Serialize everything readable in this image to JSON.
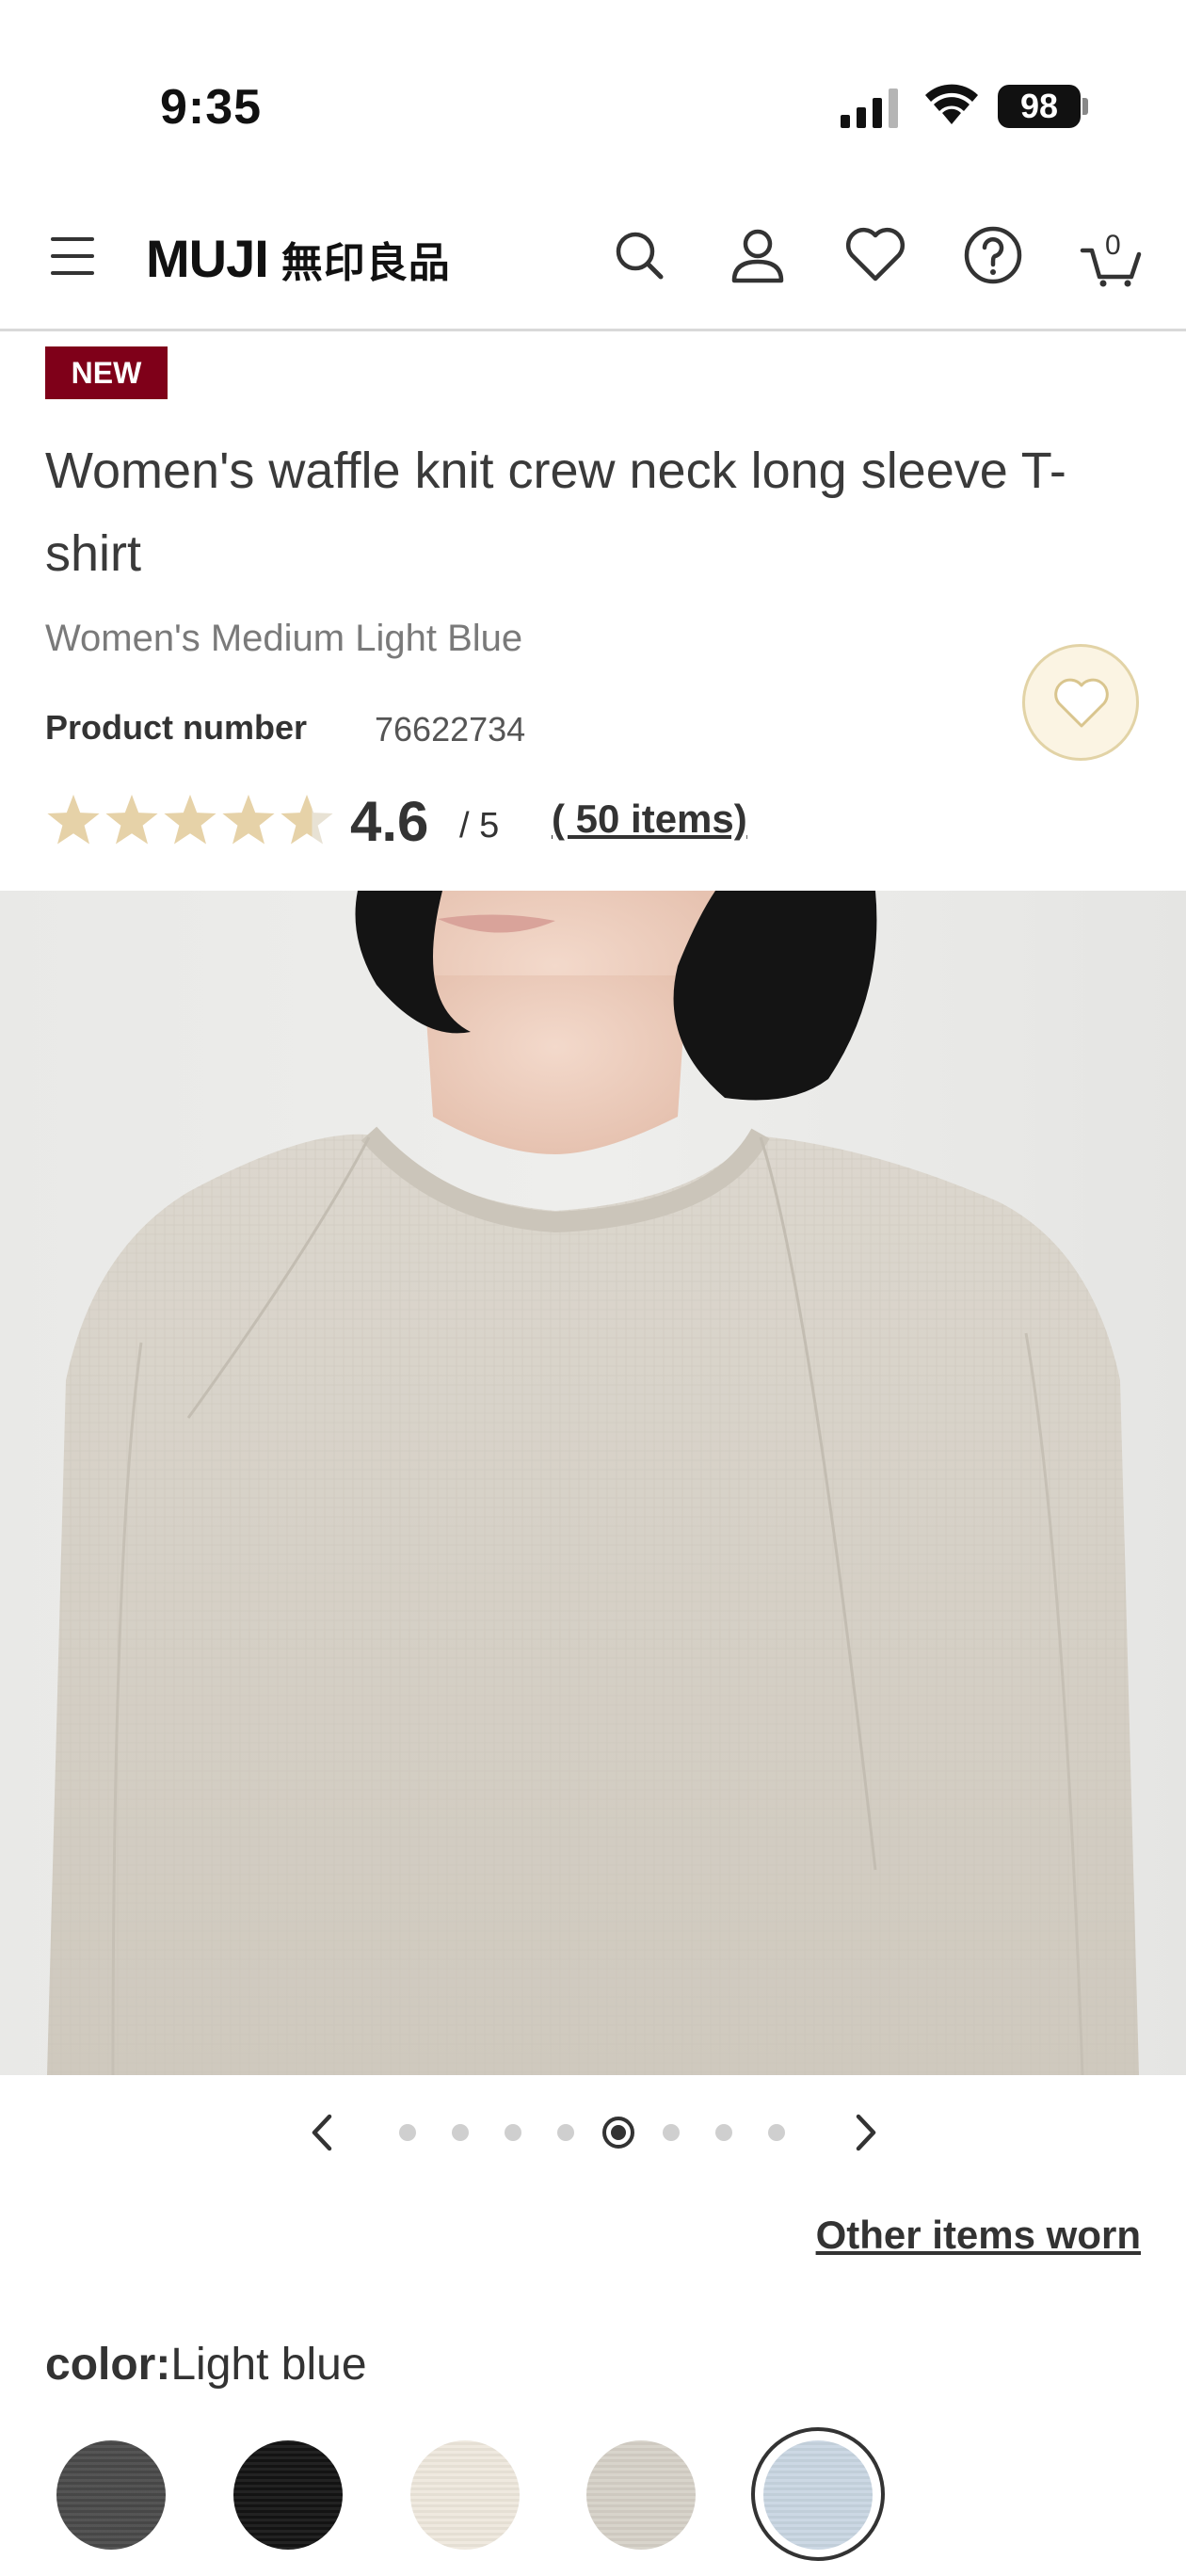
{
  "status_bar": {
    "time": "9:35",
    "battery": "98"
  },
  "header": {
    "logo_latin": "MUJI",
    "logo_kanji": "無印良品",
    "cart_count": "0"
  },
  "product": {
    "badge": "NEW",
    "title": "Women's waffle knit crew neck long sleeve T-shirt",
    "variant": "Women's Medium Light Blue",
    "product_number_label": "Product number",
    "product_number": "76622734",
    "rating_value": "4.6",
    "rating_max": "/ 5",
    "rating_count": "( 50 items)",
    "rating_stars": 4.6
  },
  "carousel": {
    "total": 8,
    "active_index": 4
  },
  "links": {
    "other_items": "Other items worn"
  },
  "color": {
    "label": "color:",
    "selected": "Light blue",
    "swatches": [
      {
        "name": "charcoal-gray",
        "hex": "#4a4a4a"
      },
      {
        "name": "black",
        "hex": "#141414"
      },
      {
        "name": "off-white",
        "hex": "#eee8dd"
      },
      {
        "name": "oatmeal",
        "hex": "#d6d1c8"
      },
      {
        "name": "light-blue",
        "hex": "#c9d6e2"
      }
    ]
  },
  "colors": {
    "new_badge": "#7f0019",
    "star": "#e6d2a8",
    "star_empty": "#e8e2d4"
  }
}
